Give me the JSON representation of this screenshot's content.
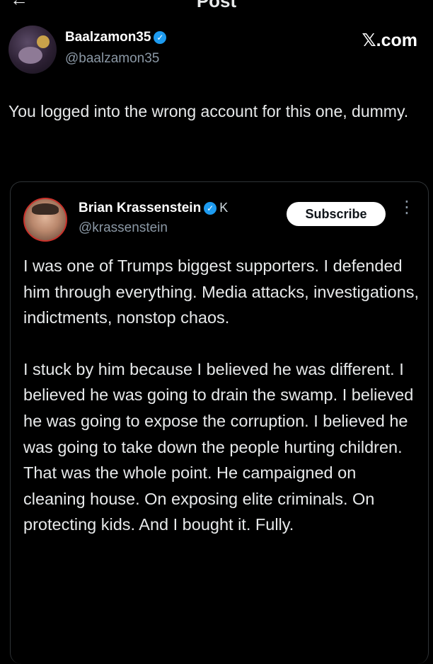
{
  "topbar": {
    "title": "Post",
    "back_icon": "arrow-left-icon"
  },
  "author": {
    "name": "Baalzamon35",
    "handle": "@baalzamon35",
    "verified": true,
    "source": "𝕏.com"
  },
  "reply": {
    "text": "You logged into the wrong account for this one, dummy."
  },
  "quoted": {
    "name": "Brian Krassenstein",
    "handle": "@krassenstein",
    "verified": true,
    "badge": "K",
    "subscribe_label": "Subscribe",
    "paragraphs": [
      "I was one of Trumps biggest supporters. I defended him through everything. Media attacks, investigations, indictments, nonstop chaos.",
      "I stuck by him because I believed he was different. I believed he was going to drain the swamp. I believed he was going to expose the corruption. I believed he was going to take down the people hurting children. That was the whole point. He campaigned on cleaning house. On exposing elite criminals. On protecting kids. And I bought it. Fully."
    ]
  },
  "colors": {
    "background": "#000000",
    "verified": "#1d9bf0",
    "muted": "#8b98a5",
    "avatar_ring": "#c9322b"
  }
}
